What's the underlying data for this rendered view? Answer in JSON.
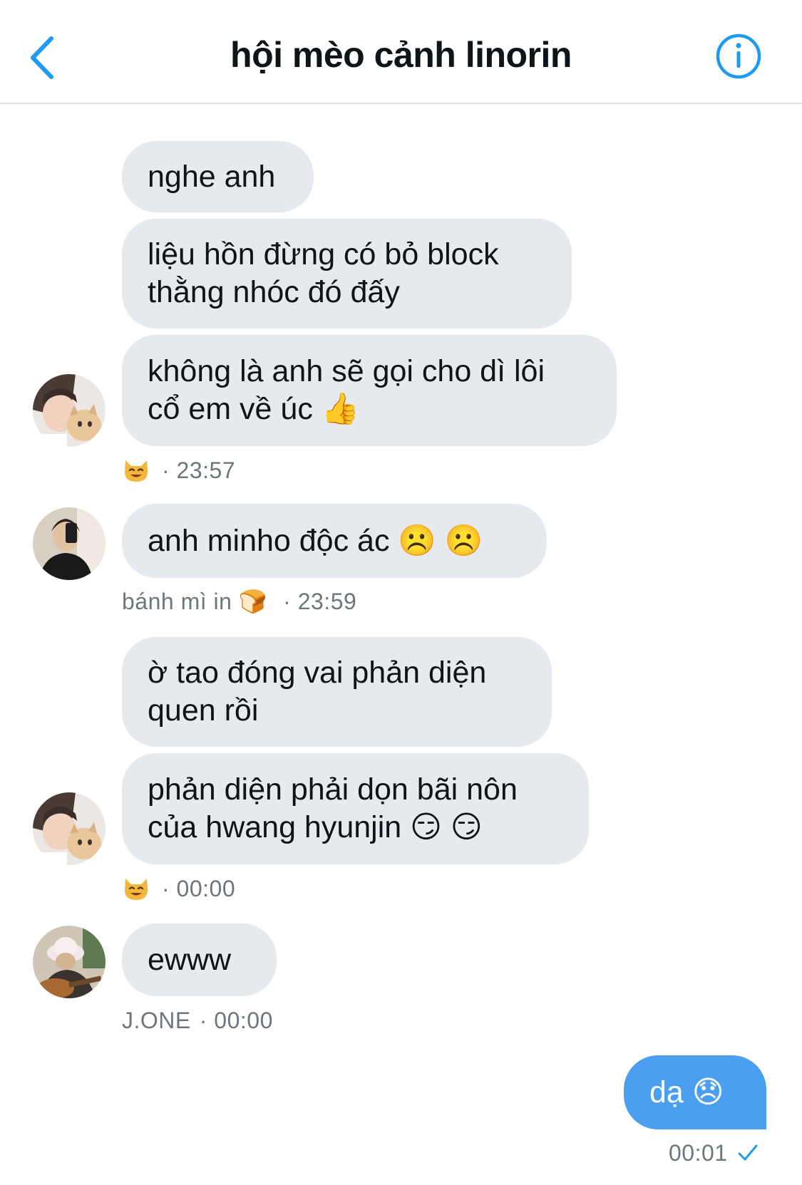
{
  "header": {
    "title": "hội mèo cảnh linorin",
    "back_icon": "chevron-left-icon",
    "info_icon": "info-icon",
    "accent_color": "#1d9bf0"
  },
  "messages": [
    {
      "id": "m1",
      "text": "nghe anh"
    },
    {
      "id": "m2",
      "text": "liệu hồn đừng có bỏ block\nthằng nhóc đó đấy"
    },
    {
      "id": "m3",
      "text": "không là anh sẽ gọi cho dì lôi\ncổ em về úc 👍"
    },
    {
      "id": "meta1",
      "sender_icon": "cat-face-emoji",
      "time": "· 23:57"
    },
    {
      "id": "m4",
      "text": "anh minho độc ác ☹️ ☹️"
    },
    {
      "id": "meta2",
      "sender": "bánh mì in 🍞",
      "time": "· 23:59"
    },
    {
      "id": "m5",
      "text": "ờ tao đóng vai phản diện\nquen rồi"
    },
    {
      "id": "m6",
      "text": "phản diện phải dọn bãi nôn\ncủa hwang hyunjin 😏 😏"
    },
    {
      "id": "meta3",
      "sender_icon": "cat-face-emoji",
      "time": "· 00:00"
    },
    {
      "id": "m7",
      "text": "ewww"
    },
    {
      "id": "meta4",
      "sender": "J.ONE",
      "time": "· 00:00"
    },
    {
      "id": "m8",
      "text": "dạ 😞",
      "outgoing": true
    },
    {
      "id": "meta5",
      "time": "00:01",
      "status_icon": "check-icon"
    }
  ]
}
